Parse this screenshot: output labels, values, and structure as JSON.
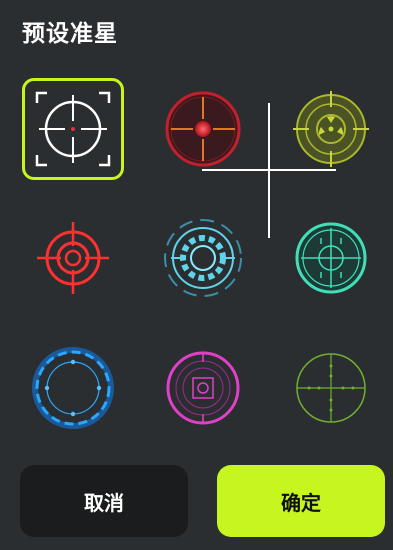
{
  "header": {
    "title": "预设准星"
  },
  "crosshairs": [
    {
      "name": "classic-bracket",
      "color": "#ffffff",
      "selected": true
    },
    {
      "name": "red-dot-scope",
      "color": "#d8262e",
      "selected": false
    },
    {
      "name": "olive-radar",
      "color": "#aab82a",
      "selected": false
    },
    {
      "name": "red-target",
      "color": "#ff3030",
      "selected": false
    },
    {
      "name": "cyan-gear",
      "color": "#5fd3ea",
      "selected": false
    },
    {
      "name": "teal-scope",
      "color": "#3fe0b8",
      "selected": false
    },
    {
      "name": "blue-dashed-ring",
      "color": "#2aa8ff",
      "selected": false
    },
    {
      "name": "magenta-ring",
      "color": "#e040c8",
      "selected": false
    },
    {
      "name": "green-mil-dot",
      "color": "#6fb030",
      "selected": false
    }
  ],
  "preview": {
    "crosshair_color": "#ffffff"
  },
  "footer": {
    "cancel_label": "取消",
    "confirm_label": "确定"
  },
  "colors": {
    "accent": "#c6f520",
    "background": "#2b2e30",
    "cancel_bg": "#1b1c1d"
  }
}
